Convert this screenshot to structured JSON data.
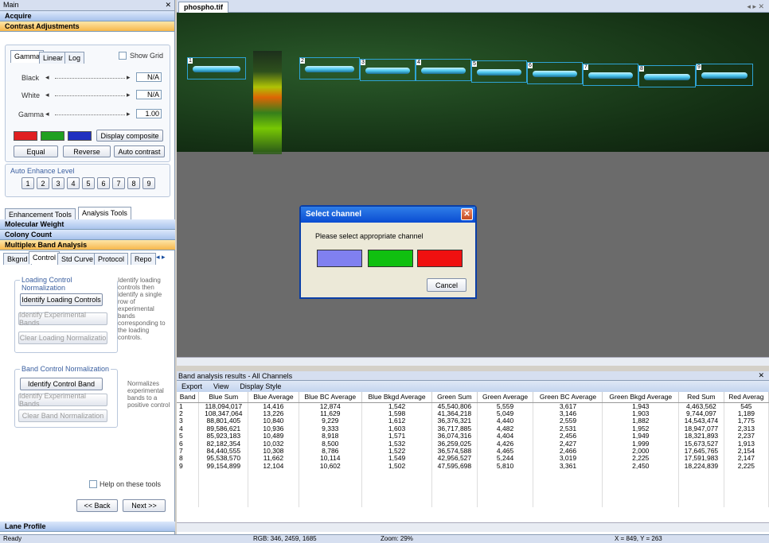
{
  "left": {
    "title": "Main",
    "title_icons": "  ✕",
    "sections_top": [
      "Acquire",
      "Contrast Adjustments"
    ],
    "tabs": [
      "Gamma",
      "Linear",
      "Log"
    ],
    "show_grid": "Show Grid",
    "sliders": [
      {
        "label": "Black",
        "value": "N/A"
      },
      {
        "label": "White",
        "value": "N/A"
      },
      {
        "label": "Gamma",
        "value": "1.00"
      }
    ],
    "display_composite": "Display composite",
    "equal": "Equal",
    "reverse": "Reverse",
    "auto_contrast": "Auto contrast",
    "auto_enhance": "Auto Enhance Level",
    "levels": [
      "1",
      "2",
      "3",
      "4",
      "5",
      "6",
      "7",
      "8",
      "9"
    ],
    "tool_tabs": [
      "Enhancement Tools",
      "Analysis Tools"
    ],
    "sections_mid": [
      "Molecular Weight",
      "Colony Count",
      "Multiplex Band Analysis"
    ],
    "sub_tabs": [
      "Bkgnd",
      "Control",
      "Std Curve",
      "Protocol",
      "Repo"
    ],
    "loading_group": "Loading Control Normalization",
    "identify_loading": "Identify Loading Controls",
    "identify_exp1": "Identify Experimental Bands",
    "clear_loading": "Clear Loading Normalizatio",
    "loading_help": "Identify loading controls then identify a single row of experimental bands corresponding to the loading controls.",
    "band_group": "Band Control Normalization",
    "identify_control": "Identify Control Band",
    "identify_exp2": "Identify Experimental Bands",
    "clear_band": "Clear Band Normalization",
    "band_help": "Normalizes experimental bands to a positive control",
    "help_tools": "Help on these tools",
    "back": "<< Back",
    "next": "Next >>",
    "lane_profile": "Lane Profile"
  },
  "doc": {
    "tab": "phospho.tif",
    "nav": "◂ ▸ ✕",
    "bands": [
      "1",
      "2",
      "3",
      "4",
      "5",
      "6",
      "7",
      "8",
      "9"
    ]
  },
  "dialog": {
    "title": "Select channel",
    "message": "Please select appropriate channel",
    "cancel": "Cancel",
    "colors": {
      "blue": "#8080f0",
      "green": "#10c010",
      "red": "#f01010"
    }
  },
  "results": {
    "title": "Band analysis results - All Channels",
    "menu": [
      "Export",
      "View",
      "Display Style"
    ],
    "columns": [
      "Band",
      "Blue Sum",
      "Blue Average",
      "Blue BC Average",
      "Blue Bkgd Average",
      "Green Sum",
      "Green Average",
      "Green BC Average",
      "Green Bkgd Average",
      "Red Sum",
      "Red Averag"
    ],
    "rows": [
      [
        "1",
        "118,094,017",
        "14,416",
        "12,874",
        "1,542",
        "45,540,806",
        "5,559",
        "3,617",
        "1,943",
        "4,463,562",
        "545"
      ],
      [
        "2",
        "108,347,064",
        "13,226",
        "11,629",
        "1,598",
        "41,364,218",
        "5,049",
        "3,146",
        "1,903",
        "9,744,097",
        "1,189"
      ],
      [
        "3",
        "88,801,405",
        "10,840",
        "9,229",
        "1,612",
        "36,376,321",
        "4,440",
        "2,559",
        "1,882",
        "14,543,474",
        "1,775"
      ],
      [
        "4",
        "89,586,621",
        "10,936",
        "9,333",
        "1,603",
        "36,717,885",
        "4,482",
        "2,531",
        "1,952",
        "18,947,077",
        "2,313"
      ],
      [
        "5",
        "85,923,183",
        "10,489",
        "8,918",
        "1,571",
        "36,074,316",
        "4,404",
        "2,456",
        "1,949",
        "18,321,893",
        "2,237"
      ],
      [
        "6",
        "82,182,354",
        "10,032",
        "8,500",
        "1,532",
        "36,259,025",
        "4,426",
        "2,427",
        "1,999",
        "15,673,527",
        "1,913"
      ],
      [
        "7",
        "84,440,555",
        "10,308",
        "8,786",
        "1,522",
        "36,574,588",
        "4,465",
        "2,466",
        "2,000",
        "17,645,765",
        "2,154"
      ],
      [
        "8",
        "95,538,570",
        "11,662",
        "10,114",
        "1,549",
        "42,956,527",
        "5,244",
        "3,019",
        "2,225",
        "17,591,983",
        "2,147"
      ],
      [
        "9",
        "99,154,899",
        "12,104",
        "10,602",
        "1,502",
        "47,595,698",
        "5,810",
        "3,361",
        "2,450",
        "18,224,839",
        "2,225"
      ]
    ]
  },
  "status": {
    "ready": "Ready",
    "rgb": "RGB: 346, 2459, 1685",
    "zoom": "Zoom: 29%",
    "coords": "X = 849, Y = 263"
  }
}
